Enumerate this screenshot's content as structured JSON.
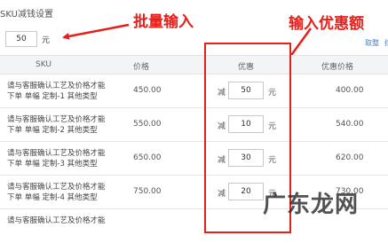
{
  "section_title": "SKU减钱设置",
  "batch": {
    "value": "50",
    "unit": "元"
  },
  "annotations": {
    "left": "批量输入",
    "right": "输入优惠额"
  },
  "links": {
    "save": "取整",
    "other": "抹"
  },
  "table": {
    "headers": {
      "sku": "SKU",
      "price": "价格",
      "discount": "优惠",
      "discount_price": "优惠价格"
    },
    "rows": [
      {
        "sku_line1": "请与客服确认工艺及价格才能",
        "sku_line2": "下单 单幅 定制-1 其他类型",
        "price": "450.00",
        "minus": "减",
        "discount": "50",
        "unit": "元",
        "discount_price": "400.00"
      },
      {
        "sku_line1": "请与客服确认工艺及价格才能",
        "sku_line2": "下单 单幅 定制-2 其他类型",
        "price": "550.00",
        "minus": "减",
        "discount": "10",
        "unit": "元",
        "discount_price": "540.00"
      },
      {
        "sku_line1": "请与客服确认工艺及价格才能",
        "sku_line2": "下单 单幅 定制-3 其他类型",
        "price": "650.00",
        "minus": "减",
        "discount": "30",
        "unit": "元",
        "discount_price": "620.00"
      },
      {
        "sku_line1": "请与客服确认工艺及价格才能",
        "sku_line2": "下单 单幅 定制-4 其他类型",
        "price": "750.00",
        "minus": "减",
        "discount": "20",
        "unit": "元",
        "discount_price": "730.00"
      },
      {
        "sku_line1": "请与客服确认工艺及价格才能",
        "sku_line2": "",
        "price": "",
        "minus": "",
        "discount": "",
        "unit": "",
        "discount_price": ""
      }
    ]
  },
  "watermark": "广东龙网",
  "colors": {
    "annotation": "#e5201b",
    "link": "#4a7cc4",
    "header_bg": "#f3f4f6"
  }
}
